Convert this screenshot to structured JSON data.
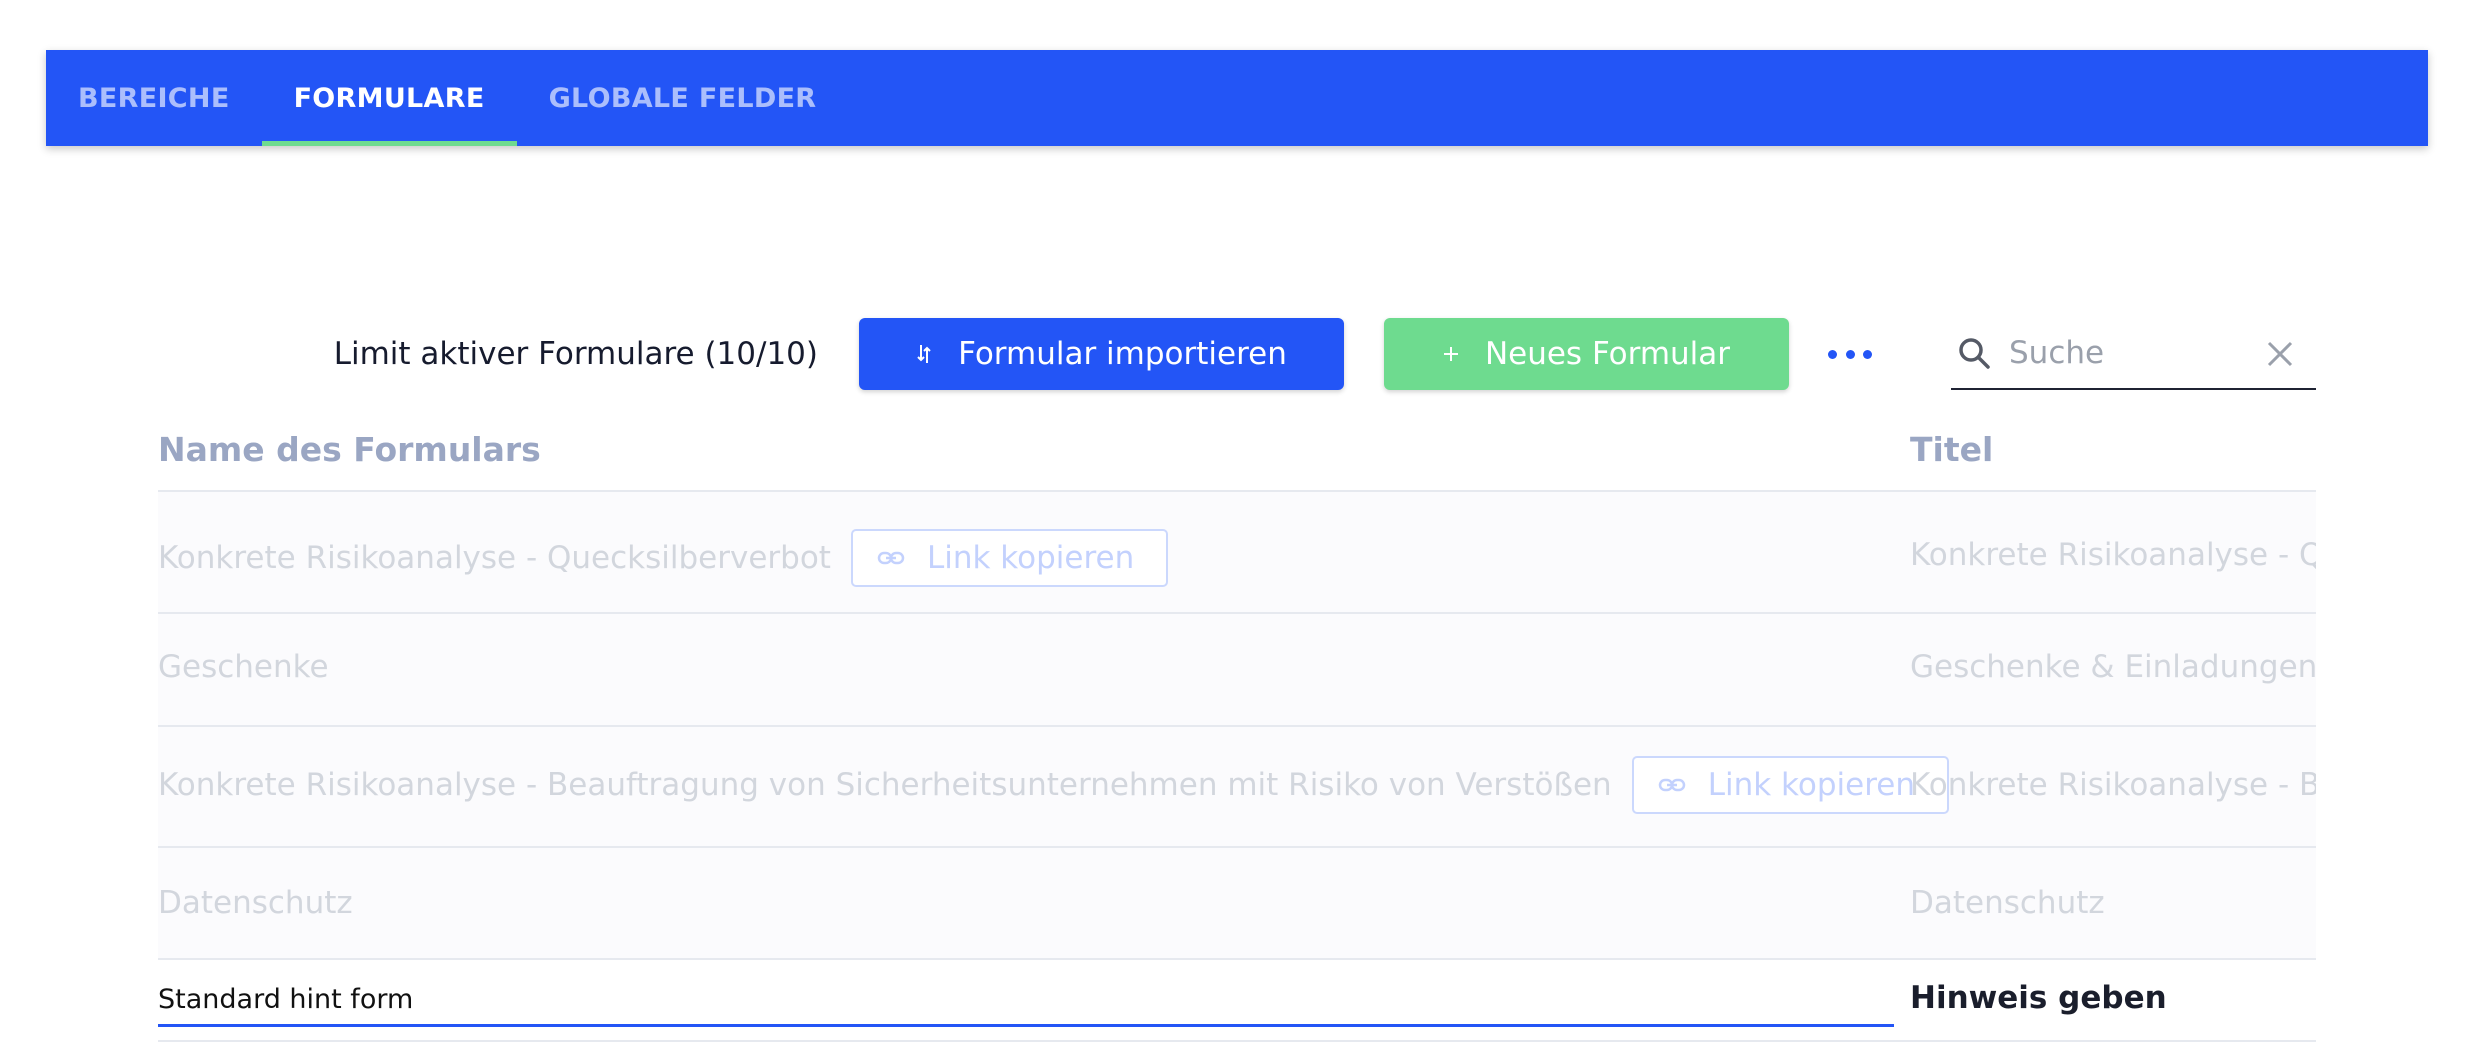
{
  "tabs": [
    {
      "label": "BEREICHE",
      "active": false
    },
    {
      "label": "FORMULARE",
      "active": true
    },
    {
      "label": "GLOBALE FELDER",
      "active": false
    }
  ],
  "toolbar": {
    "limit_label": "Limit aktiver Formulare (10/10)",
    "import_label": "Formular importieren",
    "new_label": "Neues Formular",
    "search_placeholder": "Suche",
    "search_value": ""
  },
  "table": {
    "headers": [
      "Name des Formulars",
      "Titel"
    ],
    "rows": [
      {
        "name": "Konkrete Risikoanalyse - Quecksilberverbot",
        "link_label": "Link kopieren",
        "title": "Konkrete Risikoanalyse - Quecksilberverbot"
      },
      {
        "name": "Geschenke",
        "link_label": "",
        "title": "Geschenke & Einladungen"
      },
      {
        "name": "Konkrete Risikoanalyse - Beauftragung von Sicherheitsunternehmen mit Risiko von Verstößen",
        "link_label": "Link kopieren",
        "title": "Konkrete Risikoanalyse - Beauftragung"
      },
      {
        "name": "Datenschutz",
        "link_label": "",
        "title": "Datenschutz"
      }
    ],
    "edit_row": {
      "value": "Standard hint form",
      "title": "Hinweis geben"
    }
  },
  "colors": {
    "primary": "#2355f6",
    "success": "#6edb8f",
    "header_text": "#9aa6c3"
  }
}
